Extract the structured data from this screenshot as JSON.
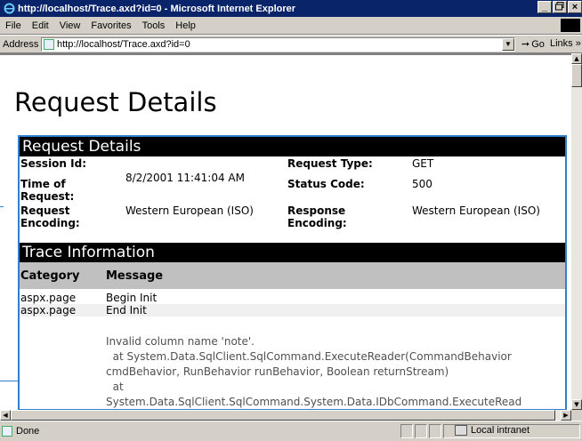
{
  "window": {
    "title": "http://localhost/Trace.axd?id=0 - Microsoft Internet Explorer",
    "minimize": "_",
    "restore": "Θ",
    "close": "×"
  },
  "menu": [
    "File",
    "Edit",
    "View",
    "Favorites",
    "Tools",
    "Help"
  ],
  "address": {
    "label": "Address",
    "value": "http://localhost/Trace.axd?id=0",
    "go": "Go",
    "links": "Links »"
  },
  "page": {
    "heading": "Request Details",
    "request_details": {
      "section_title": "Request Details",
      "rows": [
        {
          "k1": "Session Id:",
          "v1": "",
          "k2": "Request Type:",
          "v2": "GET"
        },
        {
          "k1": "Time of Request:",
          "v1": "8/2/2001 11:41:04 AM",
          "k2": "Status Code:",
          "v2": "500"
        },
        {
          "k1": "Request Encoding:",
          "v1": "Western European (ISO)",
          "k2": "Response Encoding:",
          "v2": "Western European (ISO)"
        }
      ]
    },
    "trace": {
      "section_title": "Trace Information",
      "col_category": "Category",
      "col_message": "Message",
      "rows": [
        {
          "category": "aspx.page",
          "message": "Begin Init"
        },
        {
          "category": "aspx.page",
          "message": "End Init"
        }
      ],
      "exception_lines": [
        "Invalid column name 'note'.",
        "  at System.Data.SqlClient.SqlCommand.ExecuteReader(CommandBehavior",
        "cmdBehavior, RunBehavior runBehavior, Boolean returnStream)",
        "  at",
        "System.Data.SqlClient.SqlCommand.System.Data.IDbCommand.ExecuteRead"
      ]
    }
  },
  "status": {
    "text": "Done",
    "zone": "Local intranet"
  },
  "colors": {
    "titlebar": "#0a246a",
    "selection": "#2f7fd0",
    "chrome": "#d4d0c8"
  }
}
